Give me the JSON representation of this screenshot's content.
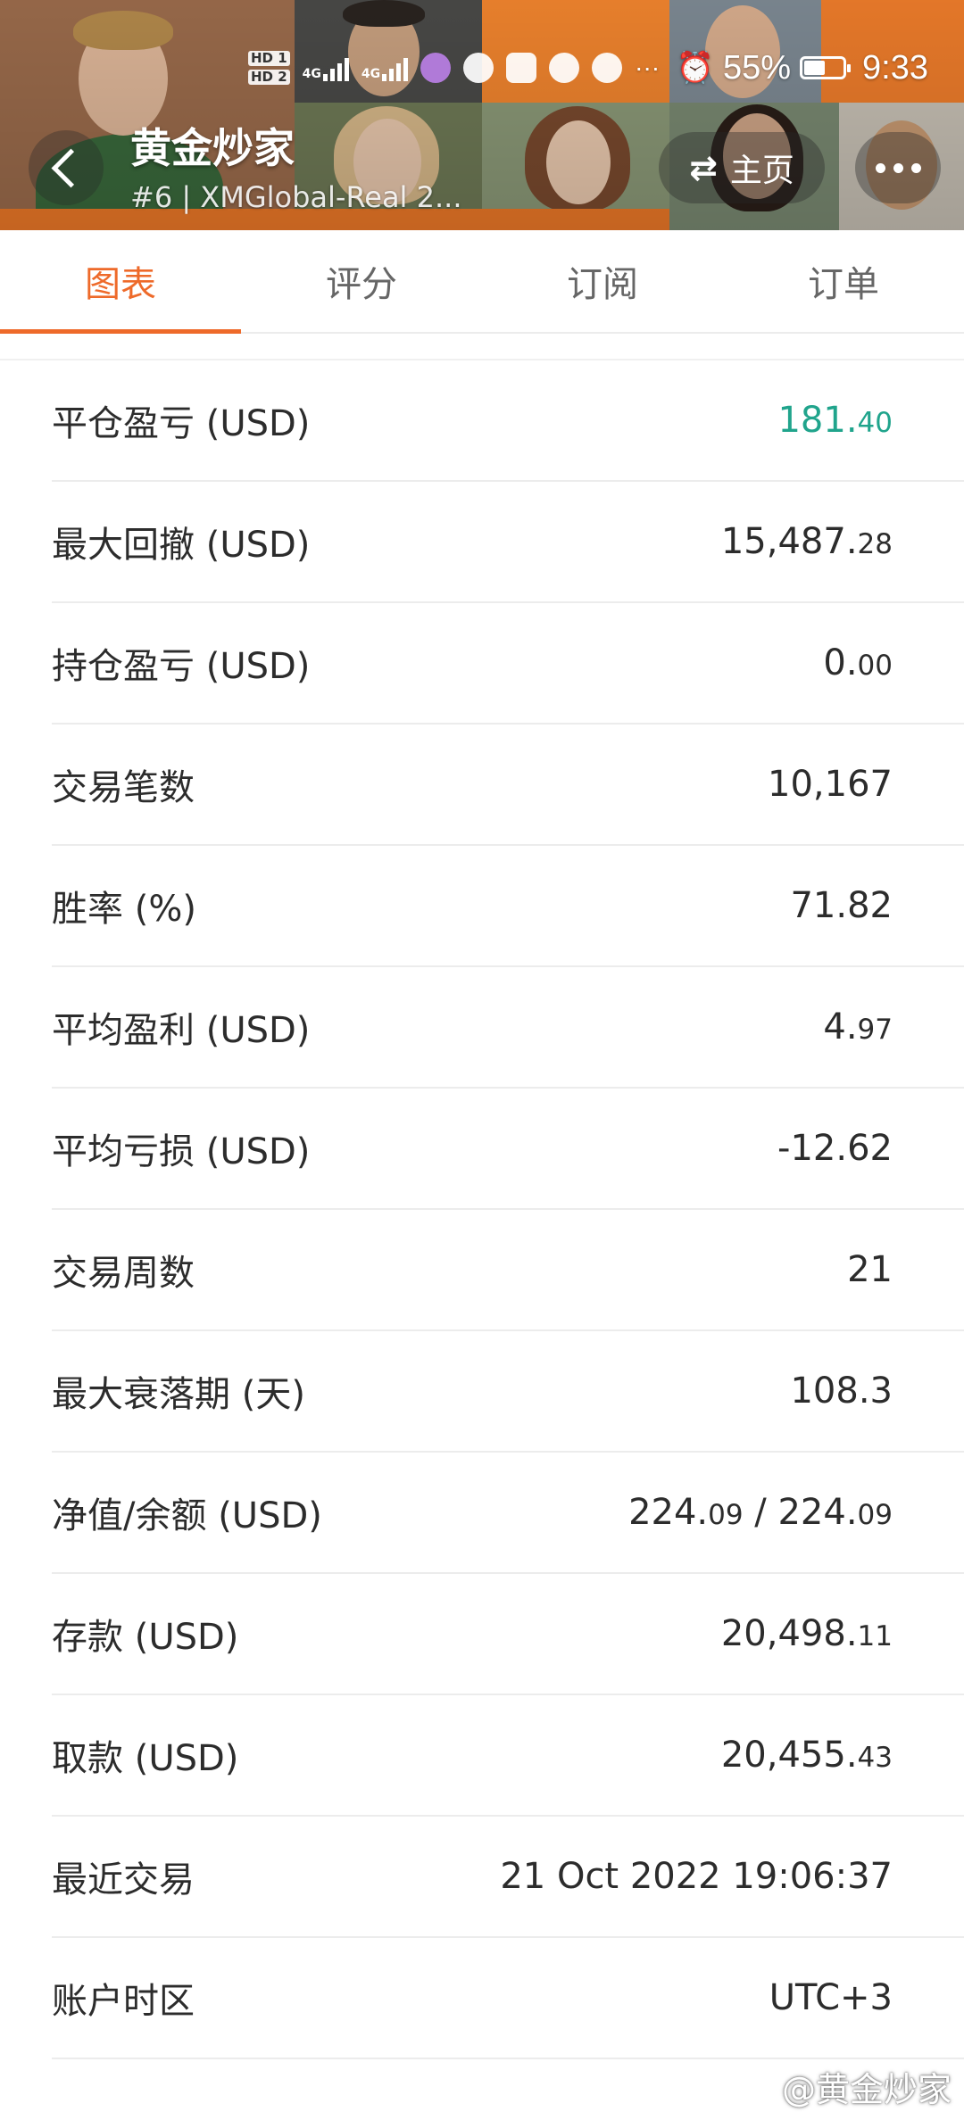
{
  "header": {
    "title": "黄金炒家",
    "subtitle": "#6 | XMGlobal-Real 2...",
    "home_label": "主页",
    "swap_icon": "swap-arrows-icon",
    "more_icon": "more-dots-icon"
  },
  "status_bar": {
    "hd1": "HD 1",
    "hd2": "HD 2",
    "net1": "4G",
    "net2": "4G",
    "overflow": "···",
    "battery_text": "55%",
    "battery_level": 0.55,
    "time": "9:33"
  },
  "tabs": [
    {
      "label": "图表",
      "active": true
    },
    {
      "label": "评分",
      "active": false
    },
    {
      "label": "订阅",
      "active": false
    },
    {
      "label": "订单",
      "active": false
    }
  ],
  "stats": [
    {
      "label": "平仓盈亏 (USD)",
      "int": "181.",
      "dec": "40",
      "color": "#20a48c"
    },
    {
      "label": "最大回撤 (USD)",
      "int": "15,487.",
      "dec": "28"
    },
    {
      "label": "持仓盈亏 (USD)",
      "int": "0.",
      "dec": "00"
    },
    {
      "label": "交易笔数",
      "int": "10,167",
      "dec": ""
    },
    {
      "label": "胜率 (%)",
      "int": "71.82",
      "dec": ""
    },
    {
      "label": "平均盈利 (USD)",
      "int": "4.",
      "dec": "97"
    },
    {
      "label": "平均亏损 (USD)",
      "int": "-12.62",
      "dec": ""
    },
    {
      "label": "交易周数",
      "int": "21",
      "dec": ""
    },
    {
      "label": "最大衰落期 (天)",
      "int": "108.3",
      "dec": ""
    },
    {
      "label": "净值/余额 (USD)",
      "int": "224.",
      "dec": "09",
      "int2": " / 224.",
      "dec2": "09"
    },
    {
      "label": "存款 (USD)",
      "int": "20,498.",
      "dec": "11"
    },
    {
      "label": "取款 (USD)",
      "int": "20,455.",
      "dec": "43"
    },
    {
      "label": "最近交易",
      "int": "21 Oct 2022 19:06:37",
      "dec": ""
    },
    {
      "label": "账户时区",
      "int": "UTC+3",
      "dec": ""
    }
  ],
  "watermark": "@黄金炒家"
}
